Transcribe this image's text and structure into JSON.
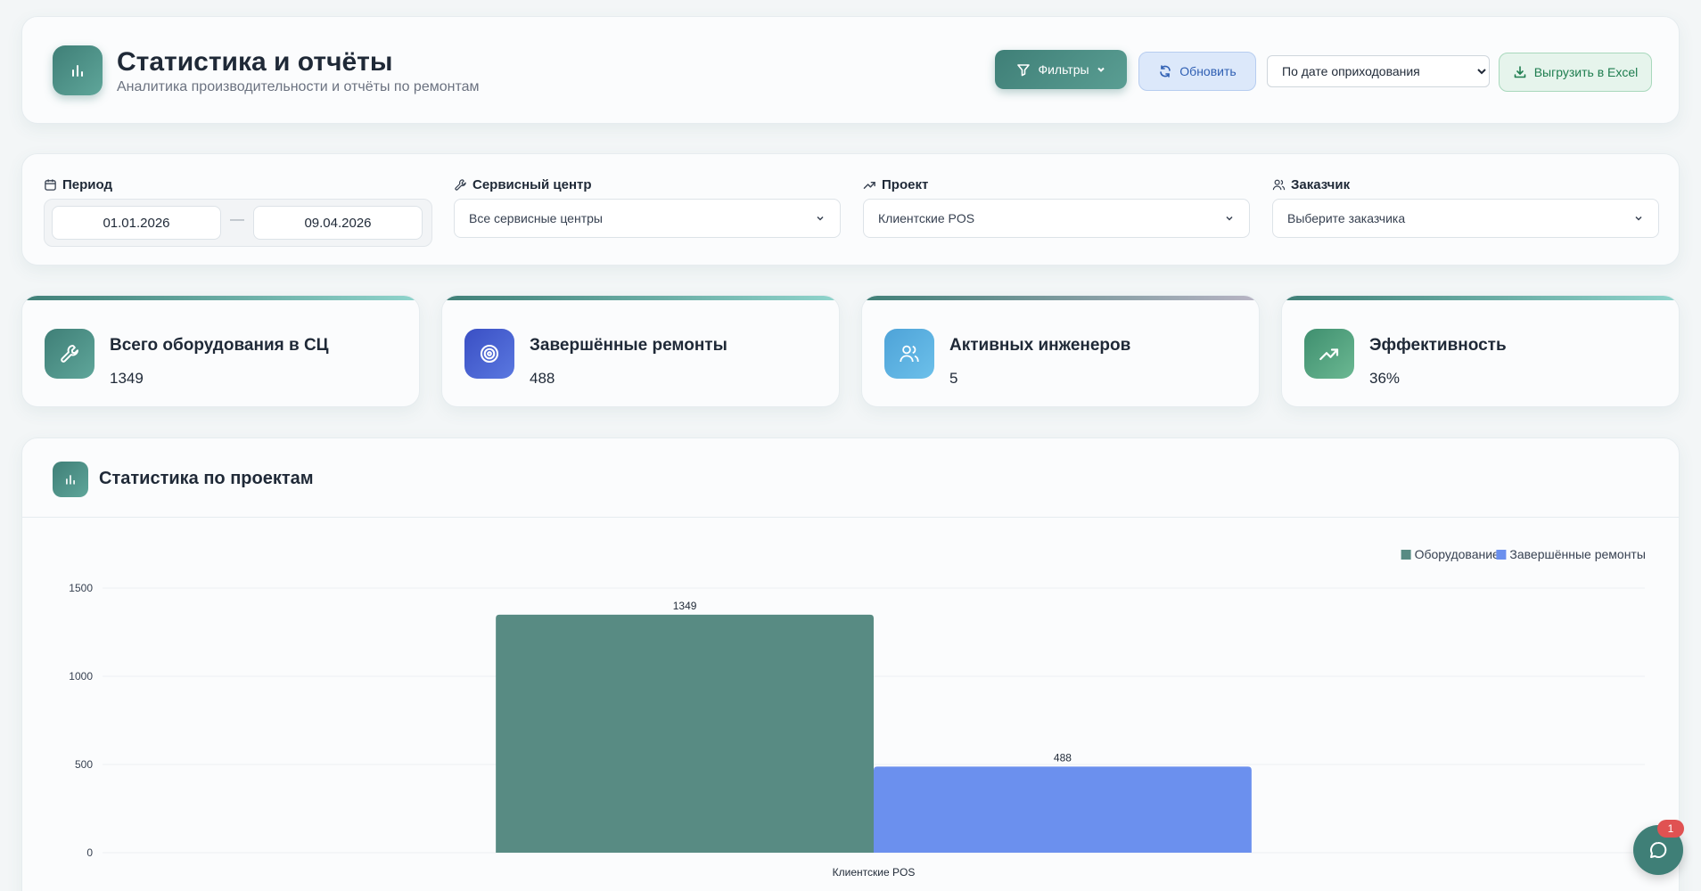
{
  "header": {
    "title": "Статистика и отчёты",
    "subtitle": "Аналитика производительности и отчёты по ремонтам",
    "filters_label": "Фильтры",
    "refresh_label": "Обновить",
    "sort_selected": "По дате оприходования",
    "export_label": "Выгрузить в Excel"
  },
  "filters": {
    "period_label": "Период",
    "date_from": "01.01.2026",
    "date_to": "09.04.2026",
    "date_sep": "—",
    "service_label": "Сервисный центр",
    "service_value": "Все сервисные центры",
    "project_label": "Проект",
    "project_value": "Клиентские POS",
    "customer_label": "Заказчик",
    "customer_value": "Выберите заказчика"
  },
  "stats": [
    {
      "title": "Всего оборудования в СЦ",
      "value": "1349",
      "icon": "wrench-icon",
      "color": "#3f7f77"
    },
    {
      "title": "Завершённые ремонты",
      "value": "488",
      "icon": "target-icon",
      "color": "#4a5fd0"
    },
    {
      "title": "Активных инженеров",
      "value": "5",
      "icon": "users-icon",
      "color": "#5aaedc"
    },
    {
      "title": "Эффективность",
      "value": "36%",
      "icon": "trend-up-icon",
      "color": "#4f9f7f"
    }
  ],
  "chart": {
    "title": "Статистика по проектам"
  },
  "chat": {
    "badge": "1"
  },
  "colors": {
    "equipment": "#588b83",
    "repairs": "#6b90ee"
  },
  "chart_data": {
    "type": "bar",
    "categories": [
      "Клиентские POS"
    ],
    "series": [
      {
        "name": "Оборудование",
        "values": [
          1349
        ]
      },
      {
        "name": "Завершённые ремонты",
        "values": [
          488
        ]
      }
    ],
    "yticks": [
      "0",
      "500",
      "1000",
      "1500"
    ],
    "ylim": [
      0,
      1500
    ],
    "grid": true,
    "legend": "top-right"
  }
}
